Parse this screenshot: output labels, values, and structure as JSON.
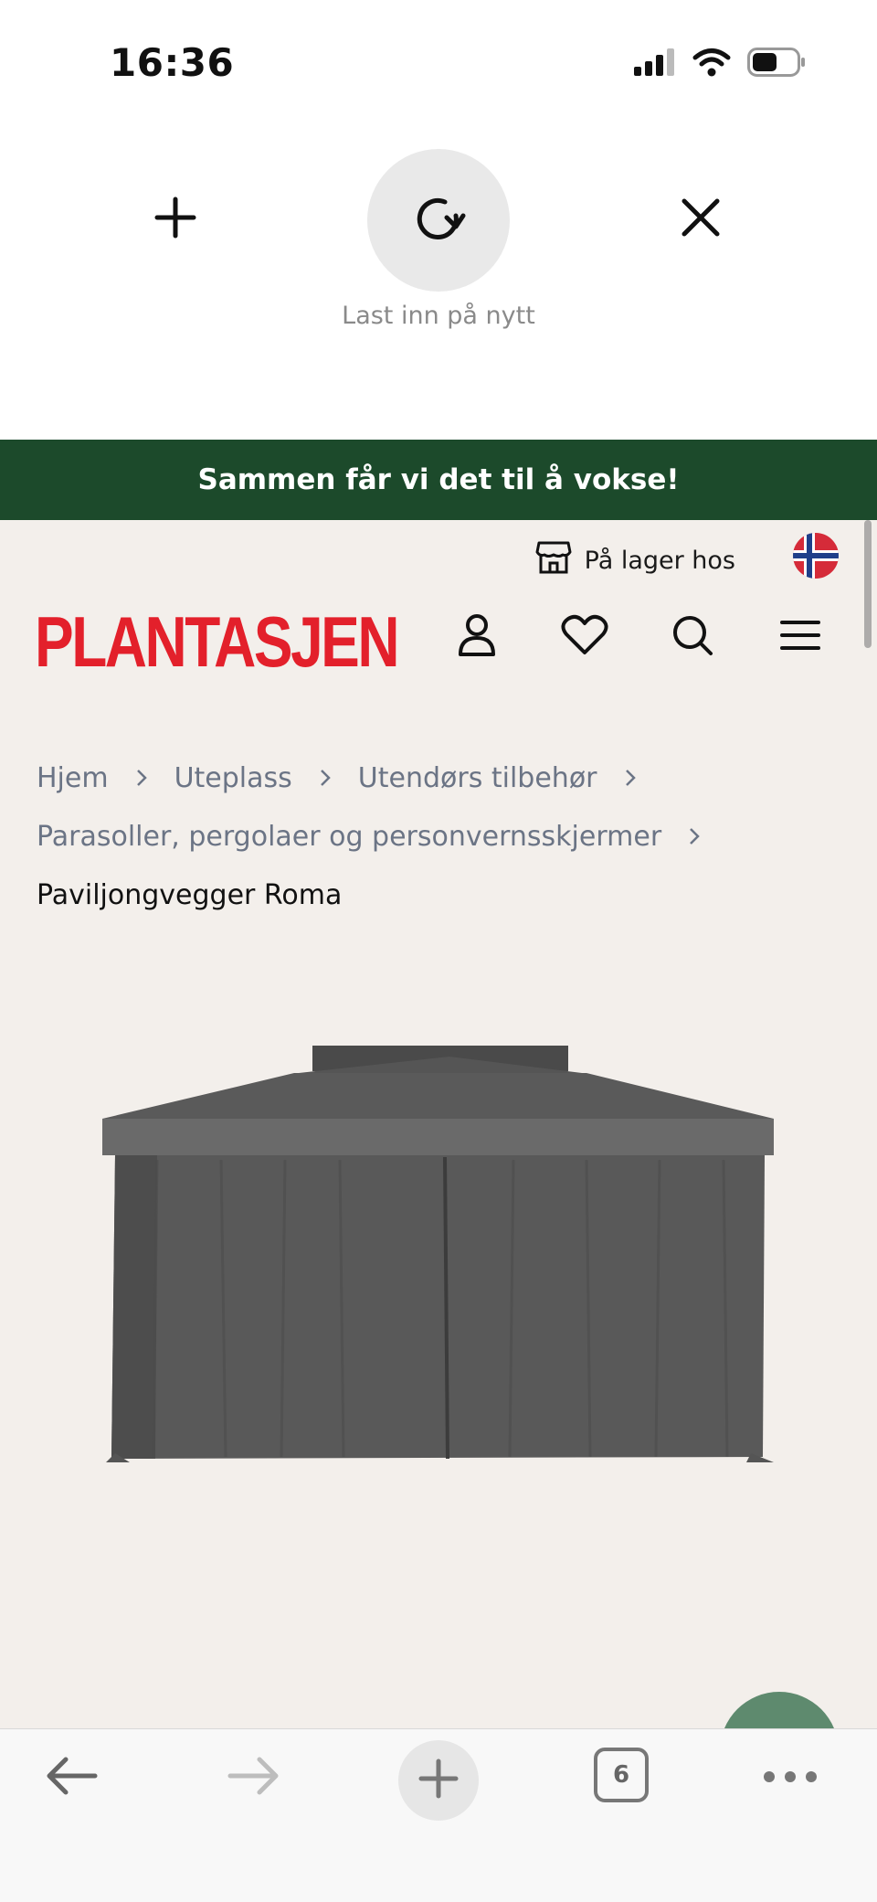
{
  "status_bar": {
    "time": "16:36"
  },
  "pull_to_refresh": {
    "reload_label": "Last inn på nytt"
  },
  "promo_banner": {
    "text": "Sammen får vi det til å vokse!"
  },
  "header": {
    "store_label": "På lager hos",
    "logo_text": "PLANTASJEN",
    "brand_color": "#e3202b"
  },
  "breadcrumb": {
    "items": [
      "Hjem",
      "Uteplass",
      "Utendørs tilbehør",
      "Parasoller, pergolaer og personvernsskjermer"
    ],
    "current": "Paviljongvegger Roma"
  },
  "toolbar": {
    "tab_count": "6"
  },
  "colors": {
    "banner_bg": "#1c4a2b",
    "page_bg": "#f3efeb",
    "fab": "#5e8a6e"
  },
  "icons": [
    "signal-icon",
    "wifi-icon",
    "battery-icon",
    "plus-icon",
    "reload-icon",
    "close-icon",
    "store-icon",
    "norway-flag-icon",
    "user-icon",
    "heart-icon",
    "search-icon",
    "menu-icon",
    "chevron-right-icon",
    "back-arrow-icon",
    "forward-arrow-icon",
    "new-tab-icon",
    "tabs-icon",
    "more-icon"
  ]
}
